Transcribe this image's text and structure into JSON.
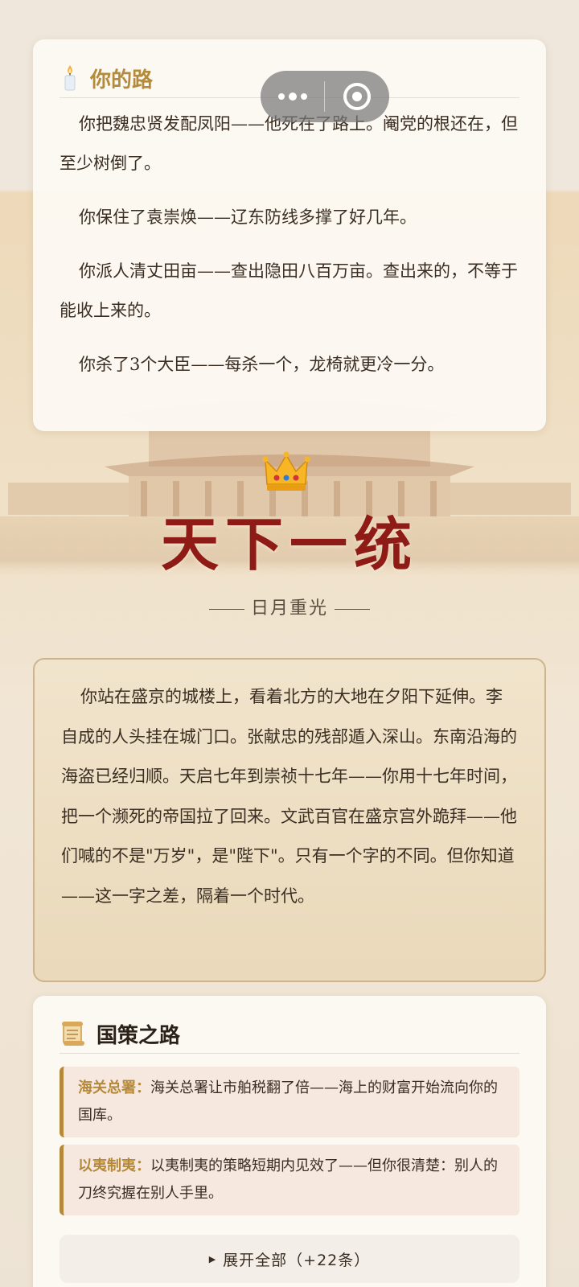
{
  "path_card": {
    "icon": "candle-icon",
    "title": "你的路",
    "paragraphs": [
      "你把魏忠贤发配凤阳——他死在了路上。阉党的根还在，但至少树倒了。",
      "你保住了袁崇焕——辽东防线多撑了好几年。",
      "你派人清丈田亩——查出隐田八百万亩。查出来的，不等于能收上来的。",
      "你杀了3个大臣——每杀一个，龙椅就更冷一分。"
    ]
  },
  "capsule": {
    "more_icon": "more-dots-icon",
    "close_icon": "target-circle-icon"
  },
  "ending": {
    "icon": "crown-icon",
    "title": "天下一统",
    "subtitle": "日月重光",
    "story": "你站在盛京的城楼上，看着北方的大地在夕阳下延伸。李自成的人头挂在城门口。张献忠的残部遁入深山。东南沿海的海盗已经归顺。天启七年到崇祯十七年——你用十七年时间，把一个濒死的帝国拉了回来。文武百官在盛京宫外跪拜——他们喊的不是\"万岁\"，是\"陛下\"。只有一个字的不同。但你知道——这一字之差，隔着一个时代。"
  },
  "policy_card": {
    "icon": "scroll-icon",
    "title": "国策之路",
    "items": [
      {
        "name": "海关总署：",
        "text": "海关总署让市舶税翻了倍——海上的财富开始流向你的国库。"
      },
      {
        "name": "以夷制夷：",
        "text": "以夷制夷的策略短期内见效了——但你很清楚：别人的刀终究握在别人手里。"
      }
    ],
    "expand_label": "展开全部（+22条）"
  },
  "colors": {
    "accent_gold": "#b4893a",
    "title_red": "#8e1b16"
  }
}
